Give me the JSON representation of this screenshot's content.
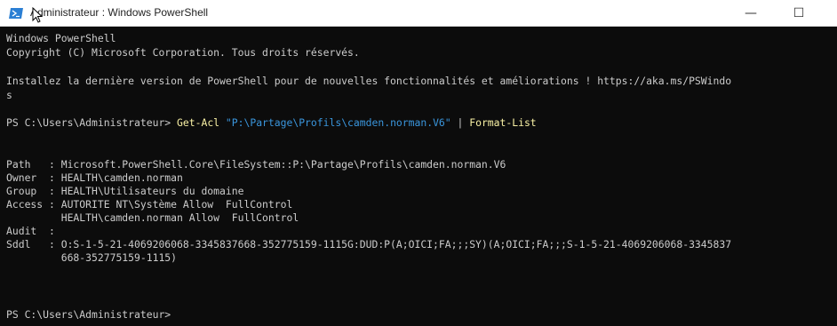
{
  "window": {
    "title": "Administrateur : Windows PowerShell",
    "controls": {
      "minimize": "—",
      "maximize": "☐",
      "close": "✕"
    }
  },
  "colors": {
    "console_bg": "#0c0c0c",
    "console_text": "#cccccc",
    "command": "#f9f1a5",
    "string": "#3a96dd",
    "icon": "#2b7fd4"
  },
  "console": {
    "header1": "Windows PowerShell",
    "header2": "Copyright (C) Microsoft Corporation. Tous droits réservés.",
    "install_line": "Installez la dernière version de PowerShell pour de nouvelles fonctionnalités et améliorations ! https://aka.ms/PSWindo",
    "install_wrap": "s",
    "prompt1": "PS C:\\Users\\Administrateur> ",
    "command": "Get-Acl",
    "argument": "\"P:\\Partage\\Profils\\camden.norman.V6\"",
    "pipe": " | ",
    "command2": "Format-List",
    "output": [
      "Path   : Microsoft.PowerShell.Core\\FileSystem::P:\\Partage\\Profils\\camden.norman.V6",
      "Owner  : HEALTH\\camden.norman",
      "Group  : HEALTH\\Utilisateurs du domaine",
      "Access : AUTORITE NT\\Système Allow  FullControl",
      "         HEALTH\\camden.norman Allow  FullControl",
      "Audit  :",
      "Sddl   : O:S-1-5-21-4069206068-3345837668-352775159-1115G:DUD:P(A;OICI;FA;;;SY)(A;OICI;FA;;;S-1-5-21-4069206068-3345837",
      "         668-352775159-1115)"
    ],
    "prompt2": "PS C:\\Users\\Administrateur>"
  }
}
